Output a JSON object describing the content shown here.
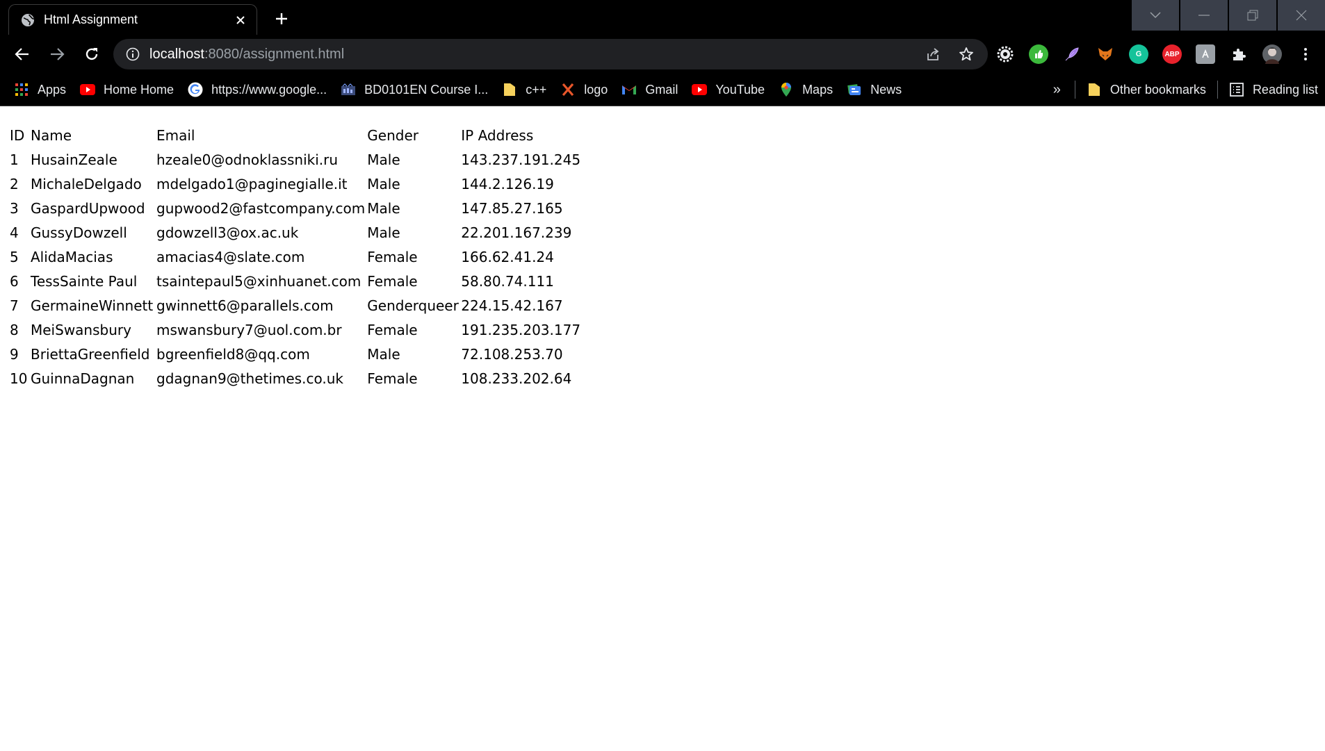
{
  "browser": {
    "tab": {
      "title": "Html Assignment",
      "favicon": "globe-icon",
      "close": "close-icon"
    },
    "new_tab": "plus-icon",
    "window_controls": [
      "chevron-down-icon",
      "minimize-icon",
      "restore-icon",
      "close-icon"
    ],
    "address_bar": {
      "host": "localhost",
      "path": ":8080/assignment.html"
    },
    "extensions": [
      "gear-icon",
      "green-thumb-icon",
      "feather-icon",
      "fox-icon",
      "grammarly-icon",
      "abp-icon",
      "font-icon",
      "puzzle-icon",
      "profile-avatar",
      "kebab-menu-icon"
    ],
    "extension_labels": {
      "abp": "ABP",
      "grammarly": "G"
    },
    "bookmarks": {
      "items": [
        {
          "label": "Apps",
          "icon": "apps-grid-icon"
        },
        {
          "label": "Home Home",
          "icon": "youtube-icon"
        },
        {
          "label": "https://www.google...",
          "icon": "google-icon"
        },
        {
          "label": "BD0101EN Course I...",
          "icon": "course-icon"
        },
        {
          "label": "c++",
          "icon": "folder-icon"
        },
        {
          "label": "logo",
          "icon": "x-logo-icon"
        },
        {
          "label": "Gmail",
          "icon": "gmail-icon"
        },
        {
          "label": "YouTube",
          "icon": "youtube-icon"
        },
        {
          "label": "Maps",
          "icon": "maps-icon"
        },
        {
          "label": "News",
          "icon": "news-icon"
        }
      ],
      "overflow": "»",
      "other_bookmarks": "Other bookmarks",
      "reading_list": "Reading list"
    }
  },
  "table": {
    "headers": [
      "ID",
      "Name",
      "Email",
      "Gender",
      "IP Address"
    ],
    "rows": [
      [
        "1",
        "HusainZeale",
        "hzeale0@odnoklassniki.ru",
        "Male",
        "143.237.191.245"
      ],
      [
        "2",
        "MichaleDelgado",
        "mdelgado1@paginegialle.it",
        "Male",
        "144.2.126.19"
      ],
      [
        "3",
        "GaspardUpwood",
        "gupwood2@fastcompany.com",
        "Male",
        "147.85.27.165"
      ],
      [
        "4",
        "GussyDowzell",
        "gdowzell3@ox.ac.uk",
        "Male",
        "22.201.167.239"
      ],
      [
        "5",
        "AlidaMacias",
        "amacias4@slate.com",
        "Female",
        "166.62.41.24"
      ],
      [
        "6",
        "TessSainte Paul",
        "tsaintepaul5@xinhuanet.com",
        "Female",
        "58.80.74.111"
      ],
      [
        "7",
        "GermaineWinnett",
        "gwinnett6@parallels.com",
        "Genderqueer",
        "224.15.42.167"
      ],
      [
        "8",
        "MeiSwansbury",
        "mswansbury7@uol.com.br",
        "Female",
        "191.235.203.177"
      ],
      [
        "9",
        "BriettaGreenfield",
        "bgreenfield8@qq.com",
        "Male",
        "72.108.253.70"
      ],
      [
        "10",
        "GuinnaDagnan",
        "gdagnan9@thetimes.co.uk",
        "Female",
        "108.233.202.64"
      ]
    ]
  }
}
